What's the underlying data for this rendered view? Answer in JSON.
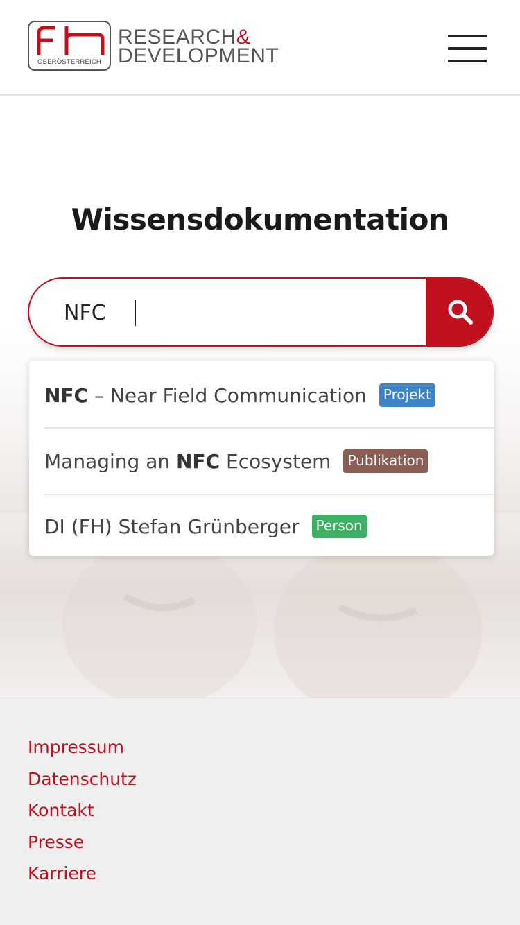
{
  "colors": {
    "brand_red": "#c0101e",
    "badge_projekt": "#3d84c6",
    "badge_publikation": "#8b5d55",
    "badge_person": "#3db162",
    "footer_bg": "#efefef"
  },
  "header": {
    "logo_mark": "fh",
    "logo_subtitle": "OBERÖSTERREICH",
    "logo_line1": "RESEARCH",
    "logo_amp": "&",
    "logo_line2": "DEVELOPMENT",
    "menu_icon": "hamburger-menu-icon"
  },
  "main": {
    "title": "Wissensdokumentation",
    "search": {
      "value": "NFC",
      "button_icon": "search-icon"
    },
    "suggestions": [
      {
        "bold": "NFC",
        "text": " – Near Field Communication",
        "badge": "Projekt"
      },
      {
        "prefix": "Managing an ",
        "bold": "NFC",
        "text": " Ecosystem",
        "badge": "Publikation"
      },
      {
        "text": "DI (FH) Stefan Grünberger",
        "badge": "Person"
      }
    ]
  },
  "footer": {
    "links": [
      "Impressum",
      "Datenschutz",
      "Kontakt",
      "Presse",
      "Karriere"
    ]
  }
}
